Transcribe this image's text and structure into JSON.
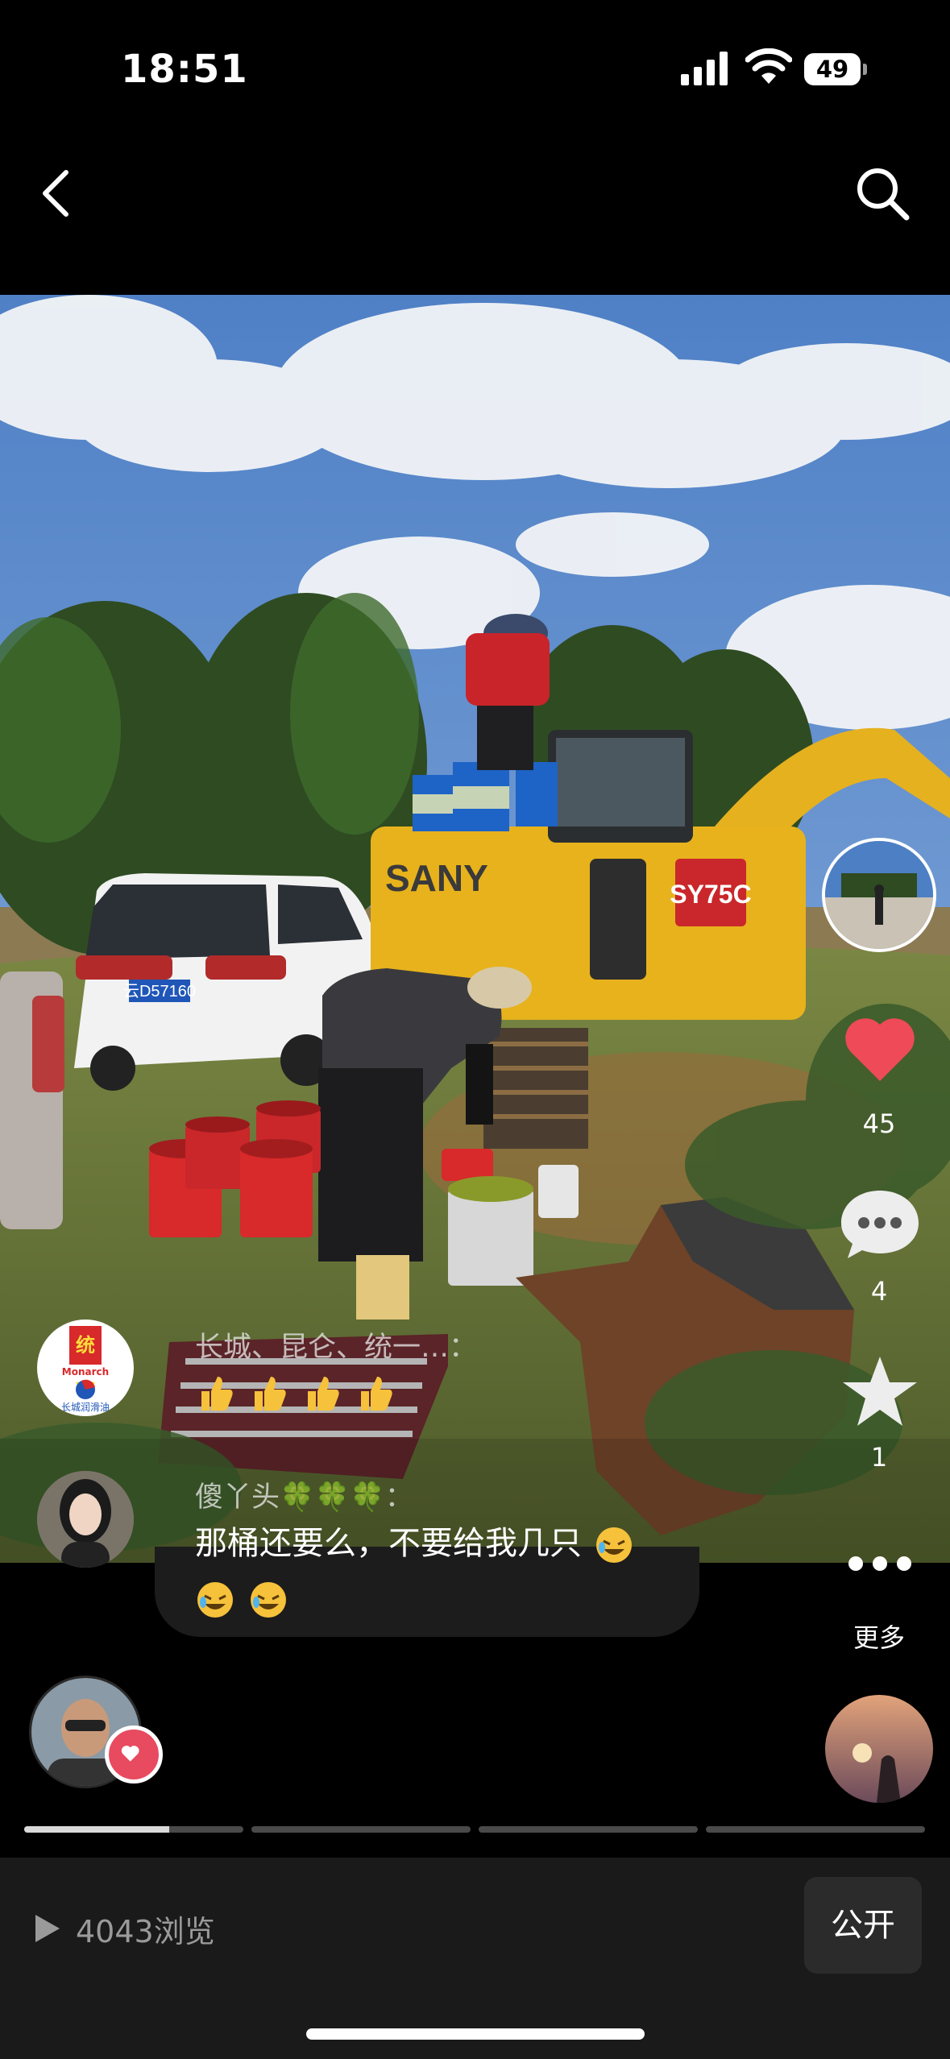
{
  "status_bar": {
    "time": "18:51",
    "battery": "49",
    "battery_level": 0.49
  },
  "nav": {
    "back_icon": "chevron-left-icon",
    "search_icon": "search-icon"
  },
  "photo": {
    "car_plate": "云D57160",
    "excavator_brand": "SANY",
    "excavator_model": "SY75C"
  },
  "actions": {
    "likes": "45",
    "comments": "4",
    "favorites": "1",
    "more_label": "更多",
    "like_color": "#ee4a58"
  },
  "comments": [
    {
      "avatar_logo_text": "统一",
      "avatar_sub_text": "Monarch",
      "avatar_caption": "长城润滑油",
      "name": "长城、昆仑、统一…：",
      "emojis": [
        "thumbs-up",
        "thumbs-up",
        "thumbs-up",
        "thumbs-up"
      ]
    },
    {
      "name": "傻丫头🍀🍀🍀：",
      "text_line1": "那桶还要么，不要给我几只",
      "line1_emojis": [
        "rolling-laughing"
      ],
      "line2_emojis": [
        "rolling-laughing",
        "rolling-laughing"
      ]
    }
  ],
  "progress": {
    "segments": 4,
    "current_index": 0,
    "current_fraction": 0.66
  },
  "bottom": {
    "views": "4043浏览",
    "public_label": "公开"
  }
}
